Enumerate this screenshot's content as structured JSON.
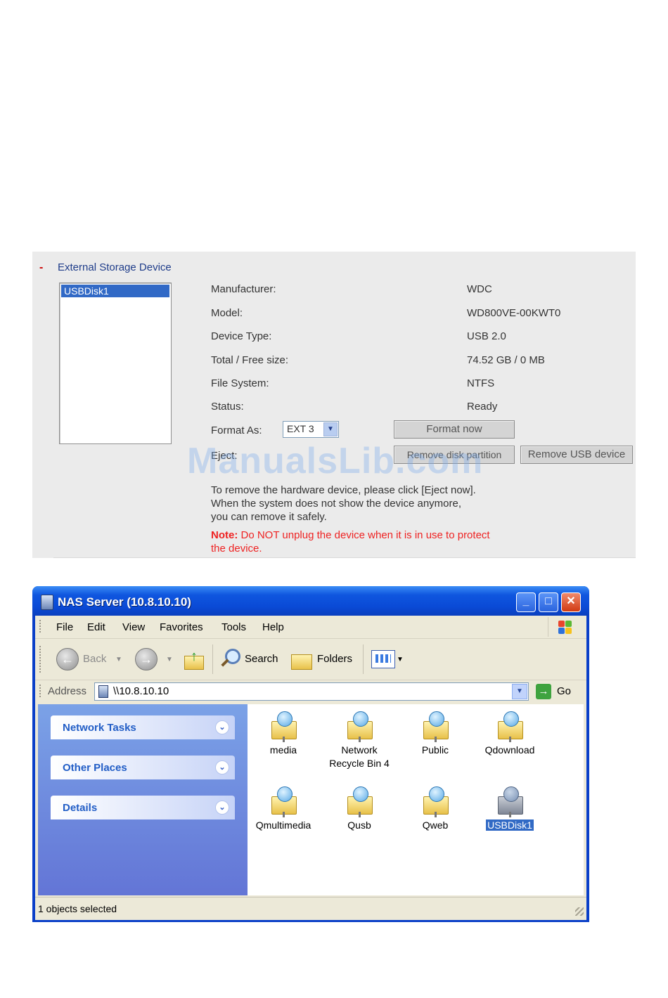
{
  "storage": {
    "collapse_symbol": "-",
    "title": "External Storage Device",
    "devices": [
      "USBDisk1"
    ],
    "fields": [
      {
        "label": "Manufacturer:",
        "value": "WDC"
      },
      {
        "label": "Model:",
        "value": "WD800VE-00KWT0"
      },
      {
        "label": "Device Type:",
        "value": "USB 2.0"
      },
      {
        "label": "Total / Free size:",
        "value": "74.52 GB / 0 MB"
      },
      {
        "label": "File System:",
        "value": "NTFS"
      },
      {
        "label": "Status:",
        "value": "Ready"
      }
    ],
    "format_label": "Format As:",
    "format_value": "EXT 3",
    "format_button": "Format now",
    "eject_label": "Eject:",
    "remove_partition_button": "Remove disk partition",
    "remove_usb_button": "Remove USB device",
    "help_lines": [
      "To remove the hardware device, please click [Eject now].",
      "When the system does not show the device anymore,",
      "you can remove it safely."
    ],
    "note_label": "Note:",
    "note_text": " Do NOT unplug the device when it is in use to protect the device."
  },
  "watermark": "ManualsLib.com",
  "explorer": {
    "title": "NAS Server (10.8.10.10)",
    "window_buttons": {
      "minimize": "_",
      "maximize": "□",
      "close": "✕"
    },
    "menu": [
      "File",
      "Edit",
      "View",
      "Favorites",
      "Tools",
      "Help"
    ],
    "toolbar": {
      "back": "Back",
      "search": "Search",
      "folders": "Folders"
    },
    "address_label": "Address",
    "address_value": "\\\\10.8.10.10",
    "go_label": "Go",
    "task_panels": [
      "Network Tasks",
      "Other Places",
      "Details"
    ],
    "items": [
      {
        "name": "media",
        "type": "share"
      },
      {
        "name": "Network Recycle Bin 4",
        "line1": "Network",
        "line2": "Recycle Bin 4",
        "type": "share"
      },
      {
        "name": "Public",
        "type": "share"
      },
      {
        "name": "Qdownload",
        "type": "share"
      },
      {
        "name": "Qmultimedia",
        "type": "share"
      },
      {
        "name": "Qusb",
        "type": "share"
      },
      {
        "name": "Qweb",
        "type": "share"
      },
      {
        "name": "USBDisk1",
        "type": "drive",
        "selected": true
      }
    ],
    "status_text": "1 objects selected"
  }
}
